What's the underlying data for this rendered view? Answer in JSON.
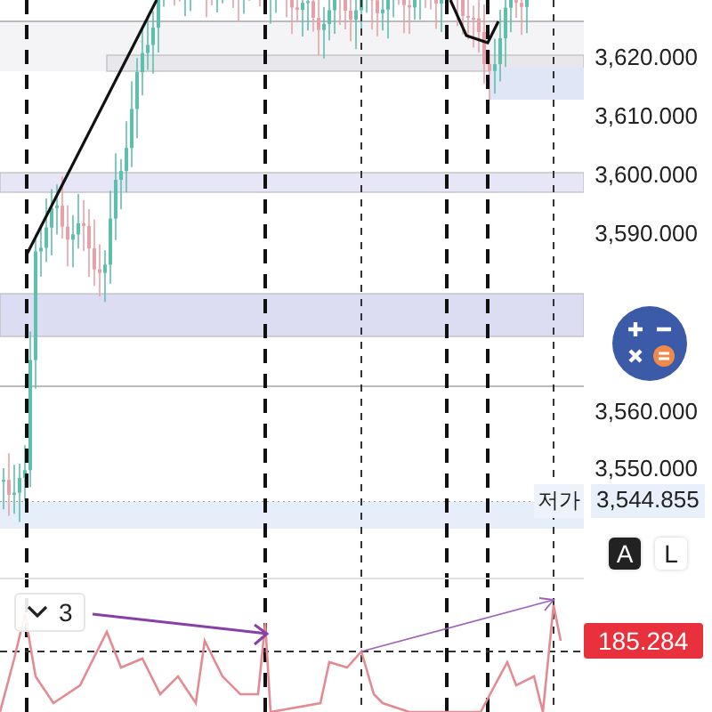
{
  "price_axis": {
    "ticks": [
      "3,620.000",
      "3,610.000",
      "3,600.000",
      "3,590.000",
      "3,560.000",
      "3,550.000"
    ]
  },
  "low_marker": {
    "label": "저가",
    "value": "3,544.855"
  },
  "scale_buttons": [
    {
      "label": "A",
      "selected": true
    },
    {
      "label": "L",
      "selected": false
    }
  ],
  "indicator": {
    "legend_count": "3",
    "value_badge": "185.284"
  }
}
